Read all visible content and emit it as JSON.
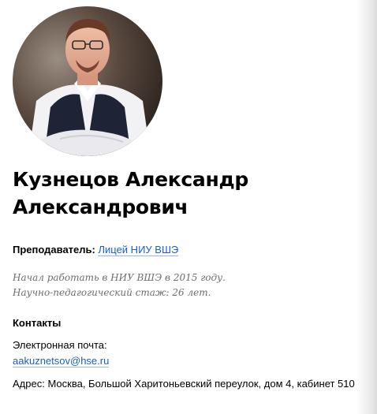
{
  "profile": {
    "name_line1": "Кузнецов Александр",
    "name_line2": "Александрович",
    "avatar_alt": "Кузнецов Александр Александрович"
  },
  "position": {
    "label": "Преподаватель:",
    "value": "Лицей НИУ ВШЭ"
  },
  "bio": {
    "line1": "Начал работать в НИУ ВШЭ в 2015 году.",
    "line2": "Научно-педагогический стаж: 26 лет."
  },
  "contacts": {
    "title": "Контакты",
    "email_label": "Электронная почта:",
    "email": "aakuznetsov@hse.ru",
    "address": "Адрес: Москва, Большой Харитоньевский переулок, дом 4, кабинет 510"
  },
  "colors": {
    "link": "#1a5ec7",
    "bio_text": "#6e6e6e"
  }
}
